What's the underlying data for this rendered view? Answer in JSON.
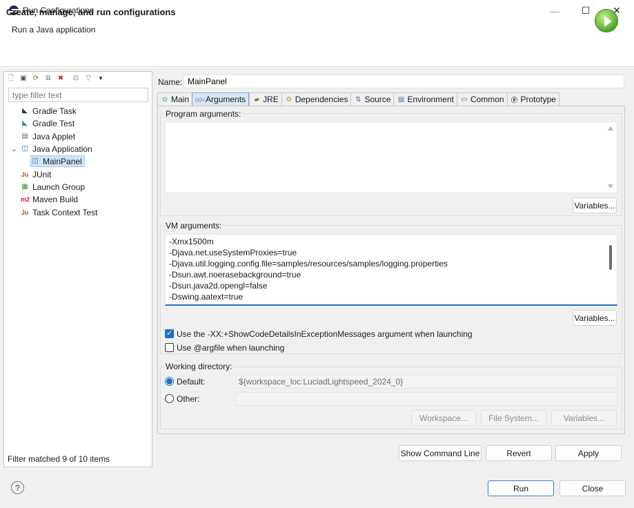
{
  "window": {
    "title": "Run Configurations",
    "minimize": "—",
    "maximize": "☐",
    "close": "✕"
  },
  "header": {
    "title": "Create, manage, and run configurations",
    "subtitle": "Run a Java application"
  },
  "left": {
    "filter_placeholder": "type filter text",
    "tree": [
      {
        "label": "Gradle Task",
        "icon": "gradle-elephant-icon"
      },
      {
        "label": "Gradle Test",
        "icon": "gradle-elephant-icon"
      },
      {
        "label": "Java Applet",
        "icon": "applet-icon"
      },
      {
        "label": "Java Application",
        "icon": "java-app-icon",
        "expanded": true
      },
      {
        "label": "MainPanel",
        "icon": "java-app-icon",
        "selected": true
      },
      {
        "label": "JUnit",
        "icon": "junit-icon"
      },
      {
        "label": "Launch Group",
        "icon": "launch-group-icon"
      },
      {
        "label": "Maven Build",
        "icon": "maven-icon"
      },
      {
        "label": "Task Context Test",
        "icon": "task-test-icon"
      }
    ],
    "status": "Filter matched 9 of 10 items"
  },
  "config": {
    "name_label": "Name:",
    "name_value": "MainPanel",
    "tabs": [
      {
        "label": "Main",
        "icon": "main-tab-icon"
      },
      {
        "label": "Arguments",
        "icon": "arguments-tab-icon",
        "active": true
      },
      {
        "label": "JRE",
        "icon": "jre-tab-icon"
      },
      {
        "label": "Dependencies",
        "icon": "dependencies-tab-icon"
      },
      {
        "label": "Source",
        "icon": "source-tab-icon"
      },
      {
        "label": "Environment",
        "icon": "environment-tab-icon"
      },
      {
        "label": "Common",
        "icon": "common-tab-icon"
      },
      {
        "label": "Prototype",
        "icon": "prototype-tab-icon"
      }
    ],
    "program_args_label": "Program arguments:",
    "program_args_value": "",
    "variables_label": "Variables...",
    "vm_args_label": "VM arguments:",
    "vm_args": [
      "-Xmx1500m",
      "-Djava.net.useSystemProxies=true",
      "-Djava.util.logging.config.file=samples/resources/samples/logging.properties",
      "-Dsun.awt.noerasebackground=true",
      "-Dsun.java2d.opengl=false",
      "-Dswing.aatext=true"
    ],
    "check_show_code": {
      "label": "Use the -XX:+ShowCodeDetailsInExceptionMessages argument when launching",
      "checked": true
    },
    "check_argfile": {
      "label": "Use @argfile when launching",
      "checked": false
    },
    "working_dir": {
      "label": "Working directory:",
      "default_label": "Default:",
      "default_value": "${workspace_loc:LuciadLightspeed_2024_0}",
      "other_label": "Other:",
      "other_value": "",
      "workspace_button": "Workspace...",
      "filesystem_button": "File System...",
      "variables_button": "Variables..."
    }
  },
  "buttons": {
    "show_command_line": "Show Command Line",
    "revert": "Revert",
    "apply": "Apply",
    "run": "Run",
    "close": "Close",
    "help": "?"
  },
  "colors": {
    "accent": "#1f6fc5",
    "selection": "#cde5f7",
    "run_green": "#4fa82b"
  }
}
